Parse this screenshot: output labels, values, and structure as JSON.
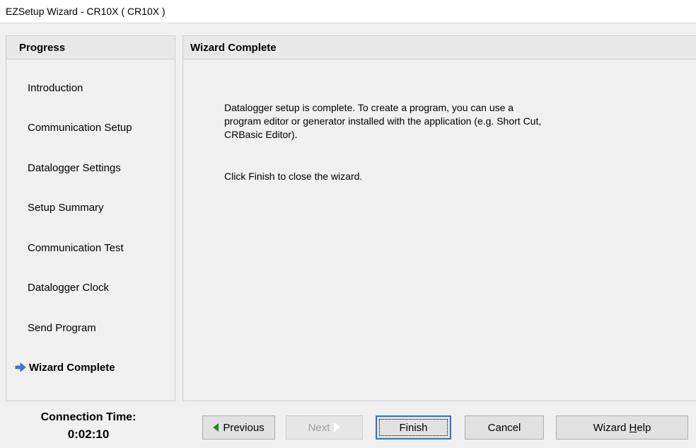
{
  "window": {
    "title": "EZSetup Wizard - CR10X ( CR10X )"
  },
  "progress": {
    "header": "Progress",
    "steps": [
      "Introduction",
      "Communication Setup",
      "Datalogger Settings",
      "Setup Summary",
      "Communication Test",
      "Datalogger Clock",
      "Send Program",
      "Wizard Complete"
    ],
    "current_step": "Wizard Complete",
    "current_icon": "arrow-right-icon"
  },
  "content": {
    "header": "Wizard Complete",
    "message_line1": "Datalogger setup is complete.  To create a program, you can use a",
    "message_line2": "program editor or generator installed with the application (e.g. Short Cut,",
    "message_line3": "CRBasic Editor).",
    "instruction": "Click Finish to close the wizard."
  },
  "connection": {
    "label": "Connection Time:",
    "value": "0:02:10"
  },
  "buttons": {
    "previous": "Previous",
    "next": "Next",
    "finish": "Finish",
    "cancel": "Cancel",
    "help_prefix": "Wizard ",
    "help_accel": "H",
    "help_suffix": "elp"
  },
  "colors": {
    "previous_arrow": "#1d8a1d",
    "current_step_arrow": "#3c78d8",
    "default_button_border": "#2b75c9"
  }
}
